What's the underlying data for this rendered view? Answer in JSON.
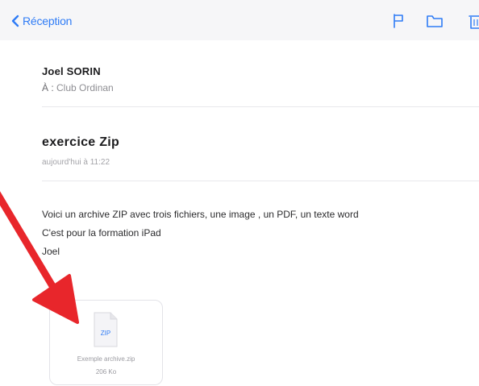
{
  "navbar": {
    "back_label": "Réception",
    "icons": [
      "flag-icon",
      "folder-icon",
      "trash-icon"
    ],
    "accent_color": "#2f7cf6"
  },
  "message": {
    "sender": "Joel SORIN",
    "recipient_prefix": "À :",
    "recipient": "Club Ordinan",
    "subject": "exercice Zip",
    "date": "aujourd'hui à 11:22",
    "body_lines": [
      "Voici un archive ZIP avec trois fichiers, une image , un PDF, un texte word",
      "C'est pour la formation iPad",
      "Joel"
    ]
  },
  "attachment": {
    "icon_label": "ZIP",
    "file_name": "Exemple archive.zip",
    "file_size": "206 Ko"
  },
  "annotation": {
    "color": "#e8262b"
  }
}
